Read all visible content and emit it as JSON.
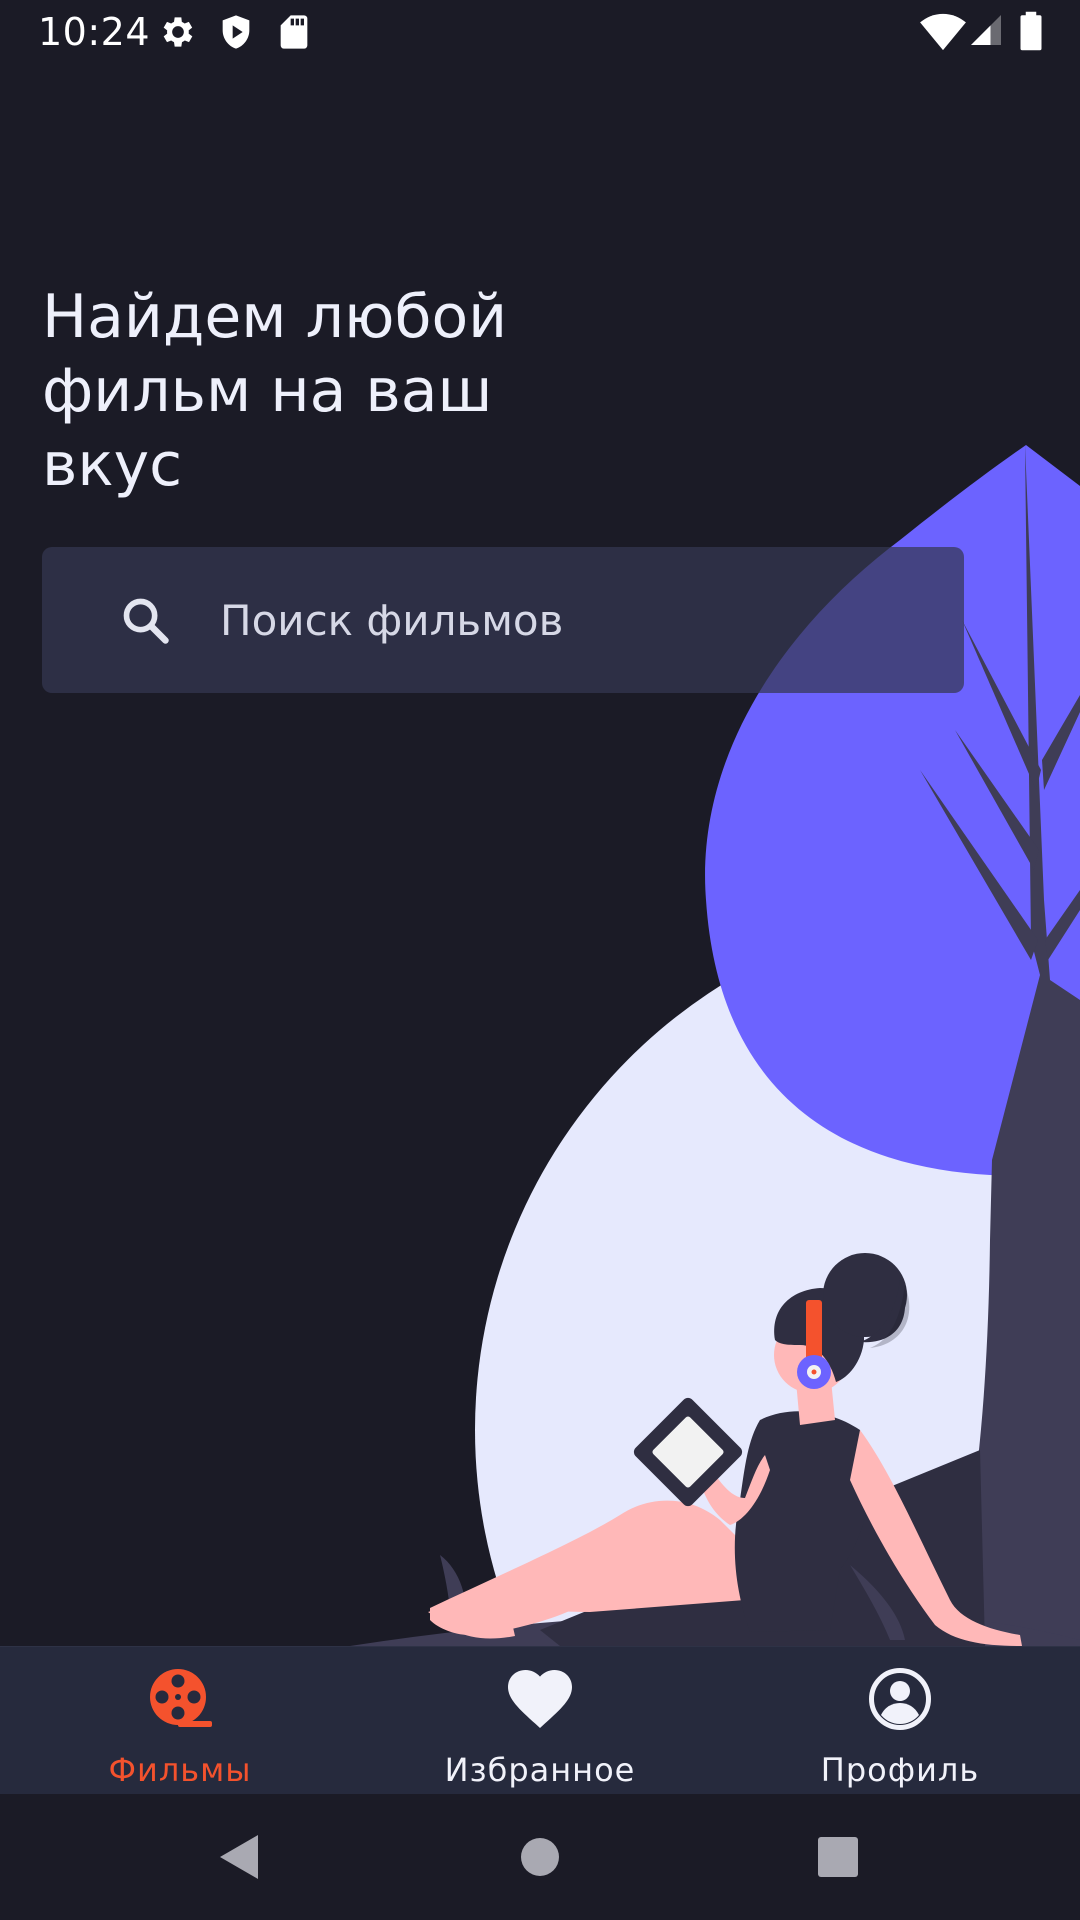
{
  "status_bar": {
    "time": "10:24",
    "left_icons": [
      "gear-icon",
      "shield-icon",
      "sd-card-icon"
    ],
    "right_icons": [
      "wifi-icon",
      "cell-signal-icon",
      "battery-icon"
    ]
  },
  "hero": {
    "headline": "Найдем любой фильм на ваш вкус"
  },
  "search": {
    "icon": "search-icon",
    "placeholder": "Поиск фильмов",
    "value": ""
  },
  "bottom_nav": {
    "items": [
      {
        "label": "Фильмы",
        "icon": "film-reel-icon",
        "active": true
      },
      {
        "label": "Избранное",
        "icon": "heart-icon",
        "active": false
      },
      {
        "label": "Профиль",
        "icon": "profile-icon",
        "active": false
      }
    ]
  },
  "system_nav": {
    "buttons": [
      "back-icon",
      "home-icon",
      "recents-icon"
    ]
  },
  "colors": {
    "background": "#1b1b26",
    "accent_active": "#f4522d",
    "nav_inactive": "#f1f2fa",
    "leaf_purple": "#6c63ff",
    "moon": "#e6e9fd",
    "nav_background": "#262a3d"
  }
}
